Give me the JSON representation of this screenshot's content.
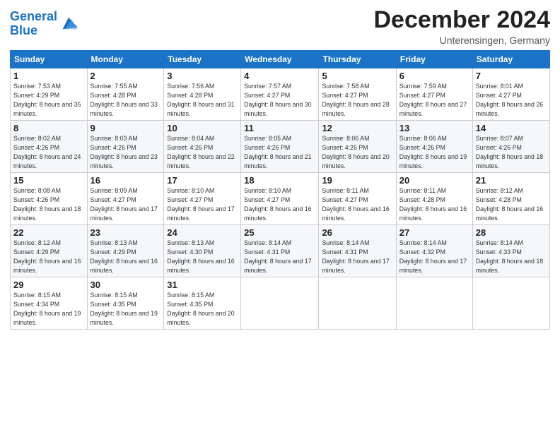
{
  "header": {
    "logo_line1": "General",
    "logo_line2": "Blue",
    "month": "December 2024",
    "location": "Unterensingen, Germany"
  },
  "days_of_week": [
    "Sunday",
    "Monday",
    "Tuesday",
    "Wednesday",
    "Thursday",
    "Friday",
    "Saturday"
  ],
  "weeks": [
    [
      {
        "day": "1",
        "sunrise": "7:53 AM",
        "sunset": "4:29 PM",
        "daylight": "8 hours and 35 minutes."
      },
      {
        "day": "2",
        "sunrise": "7:55 AM",
        "sunset": "4:28 PM",
        "daylight": "8 hours and 33 minutes."
      },
      {
        "day": "3",
        "sunrise": "7:56 AM",
        "sunset": "4:28 PM",
        "daylight": "8 hours and 31 minutes."
      },
      {
        "day": "4",
        "sunrise": "7:57 AM",
        "sunset": "4:27 PM",
        "daylight": "8 hours and 30 minutes."
      },
      {
        "day": "5",
        "sunrise": "7:58 AM",
        "sunset": "4:27 PM",
        "daylight": "8 hours and 28 minutes."
      },
      {
        "day": "6",
        "sunrise": "7:59 AM",
        "sunset": "4:27 PM",
        "daylight": "8 hours and 27 minutes."
      },
      {
        "day": "7",
        "sunrise": "8:01 AM",
        "sunset": "4:27 PM",
        "daylight": "8 hours and 26 minutes."
      }
    ],
    [
      {
        "day": "8",
        "sunrise": "8:02 AM",
        "sunset": "4:26 PM",
        "daylight": "8 hours and 24 minutes."
      },
      {
        "day": "9",
        "sunrise": "8:03 AM",
        "sunset": "4:26 PM",
        "daylight": "8 hours and 23 minutes."
      },
      {
        "day": "10",
        "sunrise": "8:04 AM",
        "sunset": "4:26 PM",
        "daylight": "8 hours and 22 minutes."
      },
      {
        "day": "11",
        "sunrise": "8:05 AM",
        "sunset": "4:26 PM",
        "daylight": "8 hours and 21 minutes."
      },
      {
        "day": "12",
        "sunrise": "8:06 AM",
        "sunset": "4:26 PM",
        "daylight": "8 hours and 20 minutes."
      },
      {
        "day": "13",
        "sunrise": "8:06 AM",
        "sunset": "4:26 PM",
        "daylight": "8 hours and 19 minutes."
      },
      {
        "day": "14",
        "sunrise": "8:07 AM",
        "sunset": "4:26 PM",
        "daylight": "8 hours and 18 minutes."
      }
    ],
    [
      {
        "day": "15",
        "sunrise": "8:08 AM",
        "sunset": "4:26 PM",
        "daylight": "8 hours and 18 minutes."
      },
      {
        "day": "16",
        "sunrise": "8:09 AM",
        "sunset": "4:27 PM",
        "daylight": "8 hours and 17 minutes."
      },
      {
        "day": "17",
        "sunrise": "8:10 AM",
        "sunset": "4:27 PM",
        "daylight": "8 hours and 17 minutes."
      },
      {
        "day": "18",
        "sunrise": "8:10 AM",
        "sunset": "4:27 PM",
        "daylight": "8 hours and 16 minutes."
      },
      {
        "day": "19",
        "sunrise": "8:11 AM",
        "sunset": "4:27 PM",
        "daylight": "8 hours and 16 minutes."
      },
      {
        "day": "20",
        "sunrise": "8:11 AM",
        "sunset": "4:28 PM",
        "daylight": "8 hours and 16 minutes."
      },
      {
        "day": "21",
        "sunrise": "8:12 AM",
        "sunset": "4:28 PM",
        "daylight": "8 hours and 16 minutes."
      }
    ],
    [
      {
        "day": "22",
        "sunrise": "8:12 AM",
        "sunset": "4:29 PM",
        "daylight": "8 hours and 16 minutes."
      },
      {
        "day": "23",
        "sunrise": "8:13 AM",
        "sunset": "4:29 PM",
        "daylight": "8 hours and 16 minutes."
      },
      {
        "day": "24",
        "sunrise": "8:13 AM",
        "sunset": "4:30 PM",
        "daylight": "8 hours and 16 minutes."
      },
      {
        "day": "25",
        "sunrise": "8:14 AM",
        "sunset": "4:31 PM",
        "daylight": "8 hours and 17 minutes."
      },
      {
        "day": "26",
        "sunrise": "8:14 AM",
        "sunset": "4:31 PM",
        "daylight": "8 hours and 17 minutes."
      },
      {
        "day": "27",
        "sunrise": "8:14 AM",
        "sunset": "4:32 PM",
        "daylight": "8 hours and 17 minutes."
      },
      {
        "day": "28",
        "sunrise": "8:14 AM",
        "sunset": "4:33 PM",
        "daylight": "8 hours and 18 minutes."
      }
    ],
    [
      {
        "day": "29",
        "sunrise": "8:15 AM",
        "sunset": "4:34 PM",
        "daylight": "8 hours and 19 minutes."
      },
      {
        "day": "30",
        "sunrise": "8:15 AM",
        "sunset": "4:35 PM",
        "daylight": "8 hours and 19 minutes."
      },
      {
        "day": "31",
        "sunrise": "8:15 AM",
        "sunset": "4:35 PM",
        "daylight": "8 hours and 20 minutes."
      },
      null,
      null,
      null,
      null
    ]
  ]
}
